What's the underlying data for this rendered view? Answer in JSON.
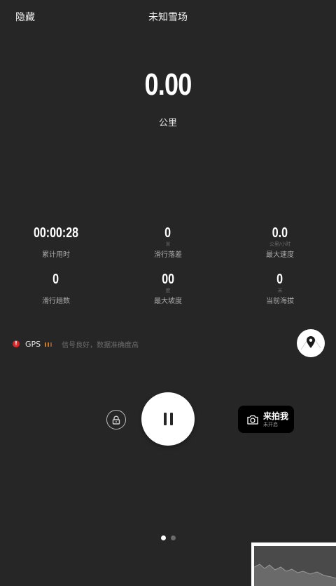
{
  "header": {
    "hide_label": "隐藏",
    "title": "未知雪场"
  },
  "distance": {
    "value": "0.00",
    "unit": "公里"
  },
  "stats": [
    {
      "value": "00:00:28",
      "unit": "",
      "label": "累计用时"
    },
    {
      "value": "0",
      "unit": "米",
      "label": "滑行落差"
    },
    {
      "value": "0.0",
      "unit": "公里/小时",
      "label": "最大速度"
    },
    {
      "value": "0",
      "unit": "",
      "label": "滑行趟数"
    },
    {
      "value": "00",
      "unit": "度",
      "label": "最大坡度"
    },
    {
      "value": "0",
      "unit": "米",
      "label": "当前海拔"
    }
  ],
  "gps": {
    "label": "GPS",
    "status": "信号良好，数据准确度高",
    "alert_symbol": "!",
    "alert_color": "#d62a2a",
    "bar_color": "#c9782c"
  },
  "controls": {
    "photo_title": "来拍我",
    "photo_subtitle": "未开启"
  },
  "icons": {
    "map": "map-pin-icon",
    "lock": "lock-icon",
    "pause": "pause-icon",
    "camera": "camera-icon"
  },
  "pager": {
    "count": 2,
    "active": 1
  }
}
